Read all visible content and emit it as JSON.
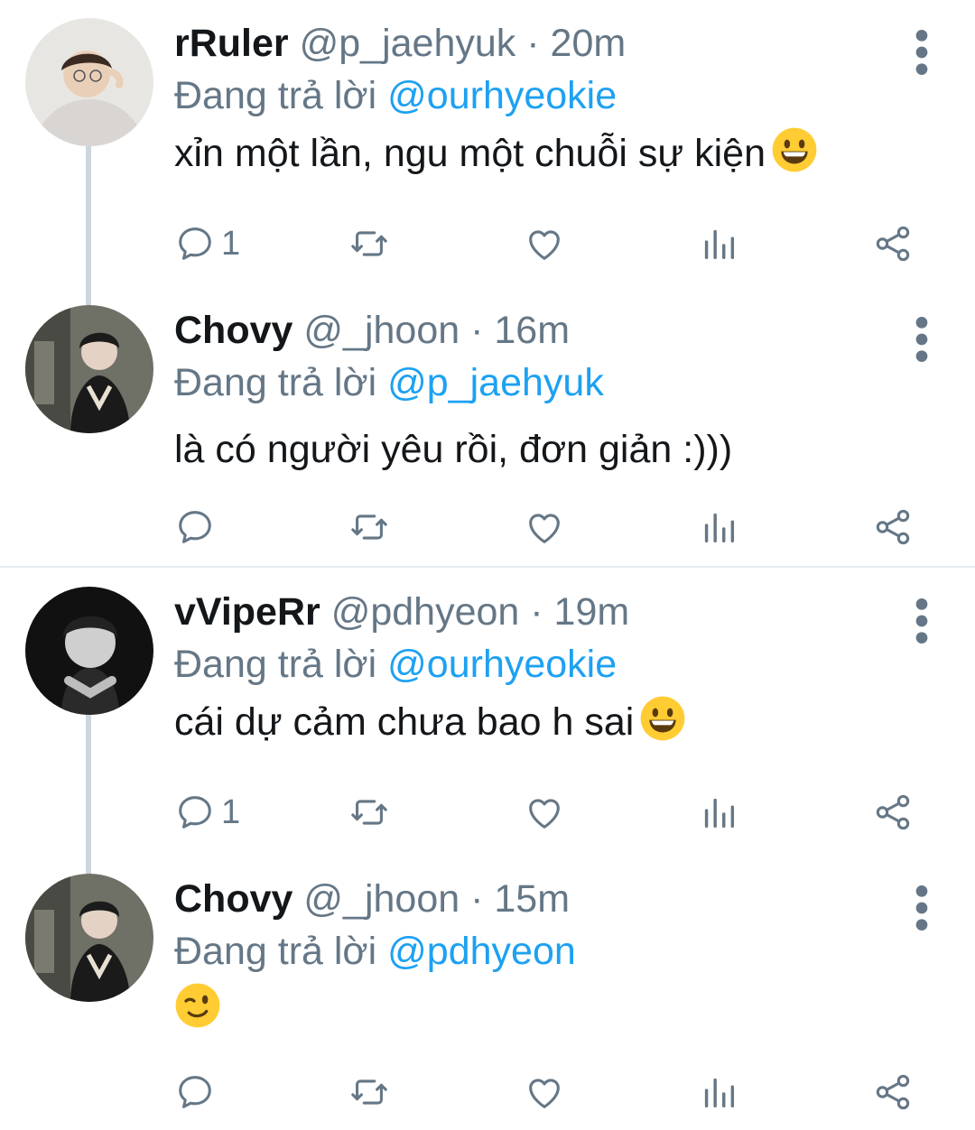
{
  "colors": {
    "accent": "#1da1f2",
    "muted": "#657786",
    "text": "#14171a",
    "line": "#ccd6dd"
  },
  "reply_prefix": "Đang trả lời",
  "tweets": [
    {
      "name": "rRuler",
      "handle": "@p_jaehyuk",
      "time": "· 20m",
      "reply_to": "@ourhyeokie",
      "text": "xỉn một lần, ngu một chuỗi sự kiện",
      "emoji": "grinning-face",
      "reply_count": "1"
    },
    {
      "name": "Chovy",
      "handle": "@_jhoon",
      "time": "· 16m",
      "reply_to": "@p_jaehyuk",
      "text": "là có người yêu rồi, đơn giản :)))",
      "emoji": "",
      "reply_count": ""
    },
    {
      "name": "vVipeRr",
      "handle": "@pdhyeon",
      "time": "· 19m",
      "reply_to": "@ourhyeokie",
      "text": "cái dự cảm chưa bao h sai",
      "emoji": "grinning-face",
      "reply_count": "1"
    },
    {
      "name": "Chovy",
      "handle": "@_jhoon",
      "time": "· 15m",
      "reply_to": "@pdhyeon",
      "text": "",
      "emoji": "winking-face",
      "reply_count": ""
    }
  ],
  "icons": [
    "reply-icon",
    "retweet-icon",
    "like-icon",
    "analytics-icon",
    "share-icon",
    "more-options-icon"
  ]
}
